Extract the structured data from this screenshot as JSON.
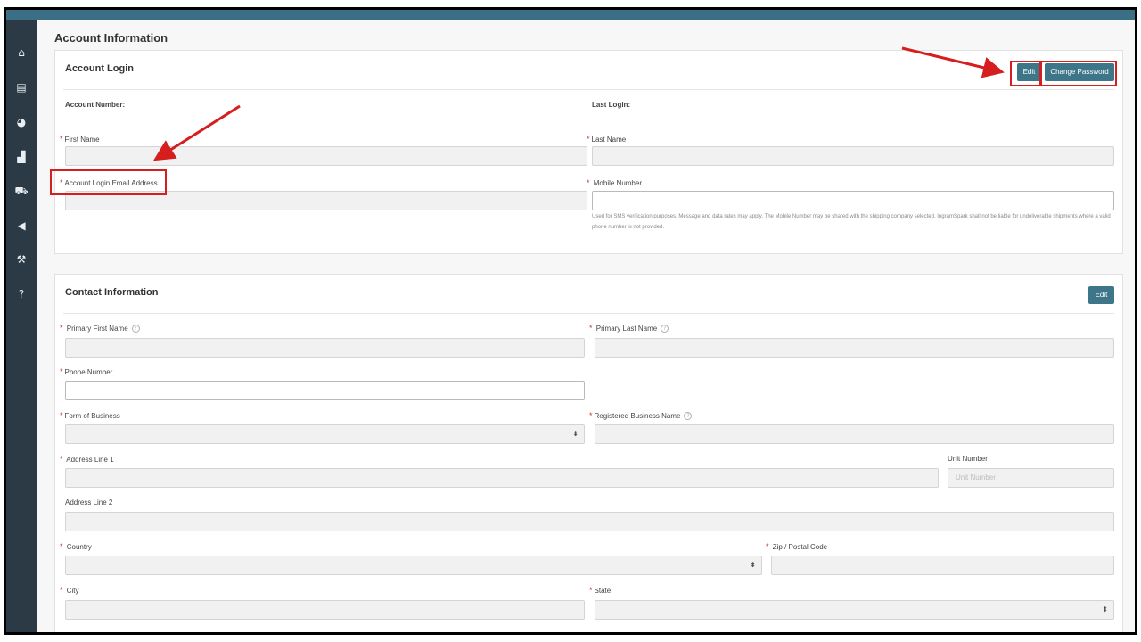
{
  "sidebar": {
    "icons": [
      "home-icon",
      "book-icon",
      "pie-chart-icon",
      "bar-chart-icon",
      "truck-icon",
      "megaphone-icon",
      "wrench-icon",
      "help-icon"
    ]
  },
  "page": {
    "title": "Account Information"
  },
  "account_login": {
    "title": "Account Login",
    "edit_label": "Edit",
    "change_password_label": "Change Password",
    "account_number_label": "Account Number:",
    "last_login_label": "Last Login:",
    "required_mark": "*",
    "first_name_label": "First Name",
    "last_name_label": "Last Name",
    "email_label": "Account Login Email Address",
    "mobile_label": "Mobile Number",
    "mobile_hint": "Used for SMS verification purposes. Message and data rates may apply. The Mobile Number may be shared with the shipping company selected. IngramSpark shall not be liable for undeliverable shipments where a valid phone number is not provided."
  },
  "contact": {
    "title": "Contact Information",
    "edit_label": "Edit",
    "primary_first_name_label": "Primary First Name",
    "primary_last_name_label": "Primary Last Name",
    "phone_label": "Phone Number",
    "form_of_business_label": "Form of Business",
    "registered_business_label": "Registered Business Name",
    "address1_label": "Address Line 1",
    "unit_label": "Unit Number",
    "unit_placeholder": "Unit Number",
    "address2_label": "Address Line 2",
    "country_label": "Country",
    "zip_label": "Zip / Postal Code",
    "city_label": "City",
    "state_label": "State"
  },
  "colors": {
    "accent": "#3d7589",
    "sidebar": "#2b3a45",
    "annotation": "#d61e1e"
  }
}
